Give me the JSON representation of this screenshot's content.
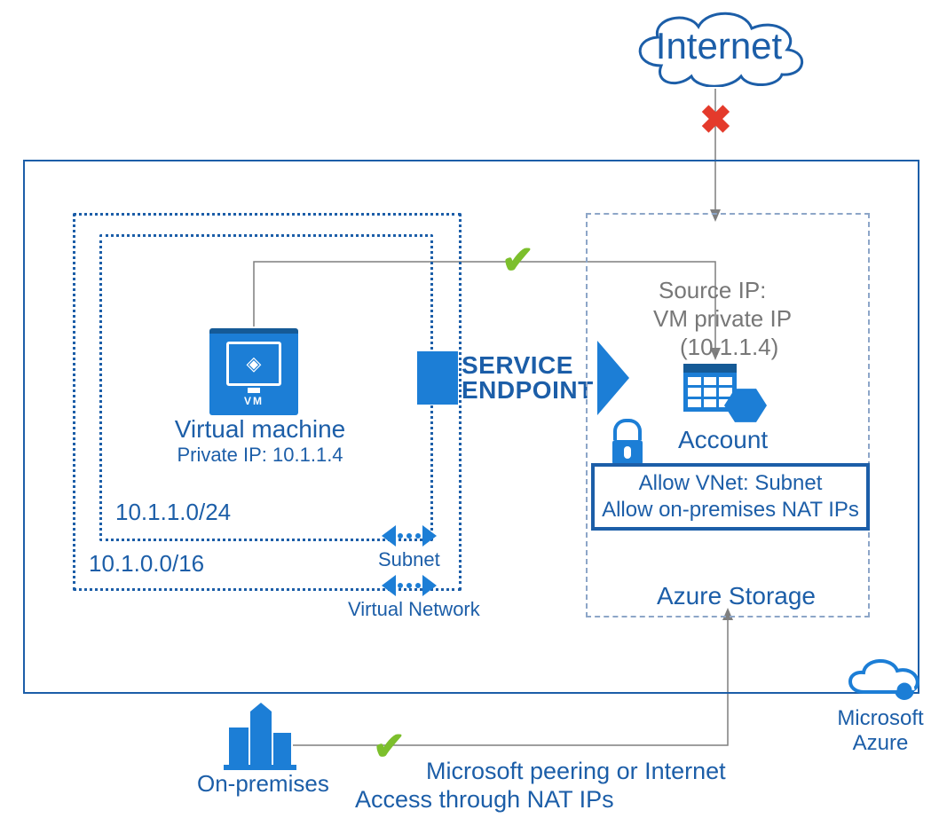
{
  "internet_label": "Internet",
  "vm": {
    "title": "Virtual machine",
    "private_ip_line": "Private IP: 10.1.1.4",
    "tile_caption": "VM"
  },
  "subnet_cidr": "10.1.1.0/24",
  "vnet_cidr": "10.1.0.0/16",
  "subnet_label": "Subnet",
  "vnet_label": "Virtual Network",
  "service_endpoint": {
    "line1": "SERVICE",
    "line2": "ENDPOINT"
  },
  "storage": {
    "source_ip_l1": "Source IP:",
    "source_ip_l2": "VM private IP",
    "source_ip_l3": "(10.1.1.4)",
    "account_label": "Account",
    "acl_l1": "Allow VNet: Subnet",
    "acl_l2": "Allow on-premises NAT IPs",
    "container_label": "Azure Storage"
  },
  "azure_brand": {
    "l1": "Microsoft",
    "l2": "Azure"
  },
  "onprem_label": "On-premises",
  "bottom_path": {
    "l1": "Microsoft peering or Internet",
    "l2": "Access through NAT IPs"
  },
  "icons": {
    "cloud": "cloud-icon",
    "cross": "cross-icon",
    "check1": "check-icon",
    "check2": "check-icon",
    "vm": "vm-icon",
    "lock": "lock-icon",
    "storage_account": "storage-account-icon",
    "azure_cloud": "azure-cloud-icon",
    "buildings": "buildings-icon",
    "bidir": "bidirectional-arrow-icon"
  }
}
